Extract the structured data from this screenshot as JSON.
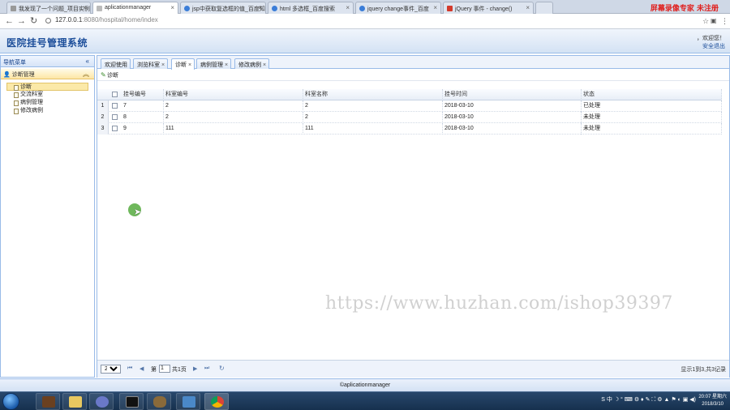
{
  "browser": {
    "tabs": [
      {
        "label": "我发现了一个问题_项目实例",
        "color": "#888888",
        "active": false
      },
      {
        "label": "aplicationmanager",
        "color": "#888888",
        "active": true
      },
      {
        "label": "jsp中获取复选框的值_百度知",
        "color": "#3b7dd8",
        "active": false
      },
      {
        "label": "html 多选框_百度搜索",
        "color": "#3b7dd8",
        "active": false
      },
      {
        "label": "jquery change事件_百度",
        "color": "#3b7dd8",
        "active": false
      },
      {
        "label": "jQuery 事件 - change()",
        "color": "#d33a2c",
        "active": false
      }
    ],
    "recorder_label": "屏幕录像专家 未注册",
    "url_host": "127.0.0.1",
    "url_rest": ":8080/hospital/home/index"
  },
  "header": {
    "title": "医院挂号管理系统",
    "welcome": "，欢迎您！",
    "logout": "安全退出"
  },
  "sidebar": {
    "title": "导航菜单",
    "group": "诊断管理",
    "items": [
      {
        "label": "诊断",
        "selected": true
      },
      {
        "label": "交流科室",
        "selected": false
      },
      {
        "label": "病例管理",
        "selected": false
      },
      {
        "label": "修改病例",
        "selected": false
      }
    ]
  },
  "tabs": [
    {
      "label": "欢迎使用",
      "closable": false,
      "active": false
    },
    {
      "label": "浏览科室",
      "closable": true,
      "active": false
    },
    {
      "label": "诊断",
      "closable": true,
      "active": true
    },
    {
      "label": "病例管理",
      "closable": true,
      "active": false
    },
    {
      "label": "修改病例",
      "closable": true,
      "active": false
    }
  ],
  "toolbar": {
    "diagnose": "诊断"
  },
  "grid": {
    "columns": [
      "挂号编号",
      "科室编号",
      "科室名称",
      "挂号时间",
      "状态"
    ],
    "rows": [
      {
        "num": "1",
        "cells": [
          "7",
          "2",
          "2",
          "2018-03-10",
          "已处理"
        ]
      },
      {
        "num": "2",
        "cells": [
          "8",
          "2",
          "2",
          "2018-03-10",
          "未处理"
        ]
      },
      {
        "num": "3",
        "cells": [
          "9",
          "111",
          "111",
          "2018-03-10",
          "未处理"
        ]
      }
    ]
  },
  "pager": {
    "page_size": "20",
    "page_prefix": "第",
    "page_value": "1",
    "page_suffix": "共1页",
    "info": "显示1到3,共3记录"
  },
  "footer": "©aplicationmanager",
  "watermark": "https://www.huzhan.com/ishop39397",
  "taskbar": {
    "tray": "S 中 ☽ ° ⌨ ⚙ ♦ ✎ ⛶ ⚙ ▲ ⚑ ◐ ▣ ◀)",
    "time": "20:07 星期六",
    "date": "2018/3/10"
  }
}
